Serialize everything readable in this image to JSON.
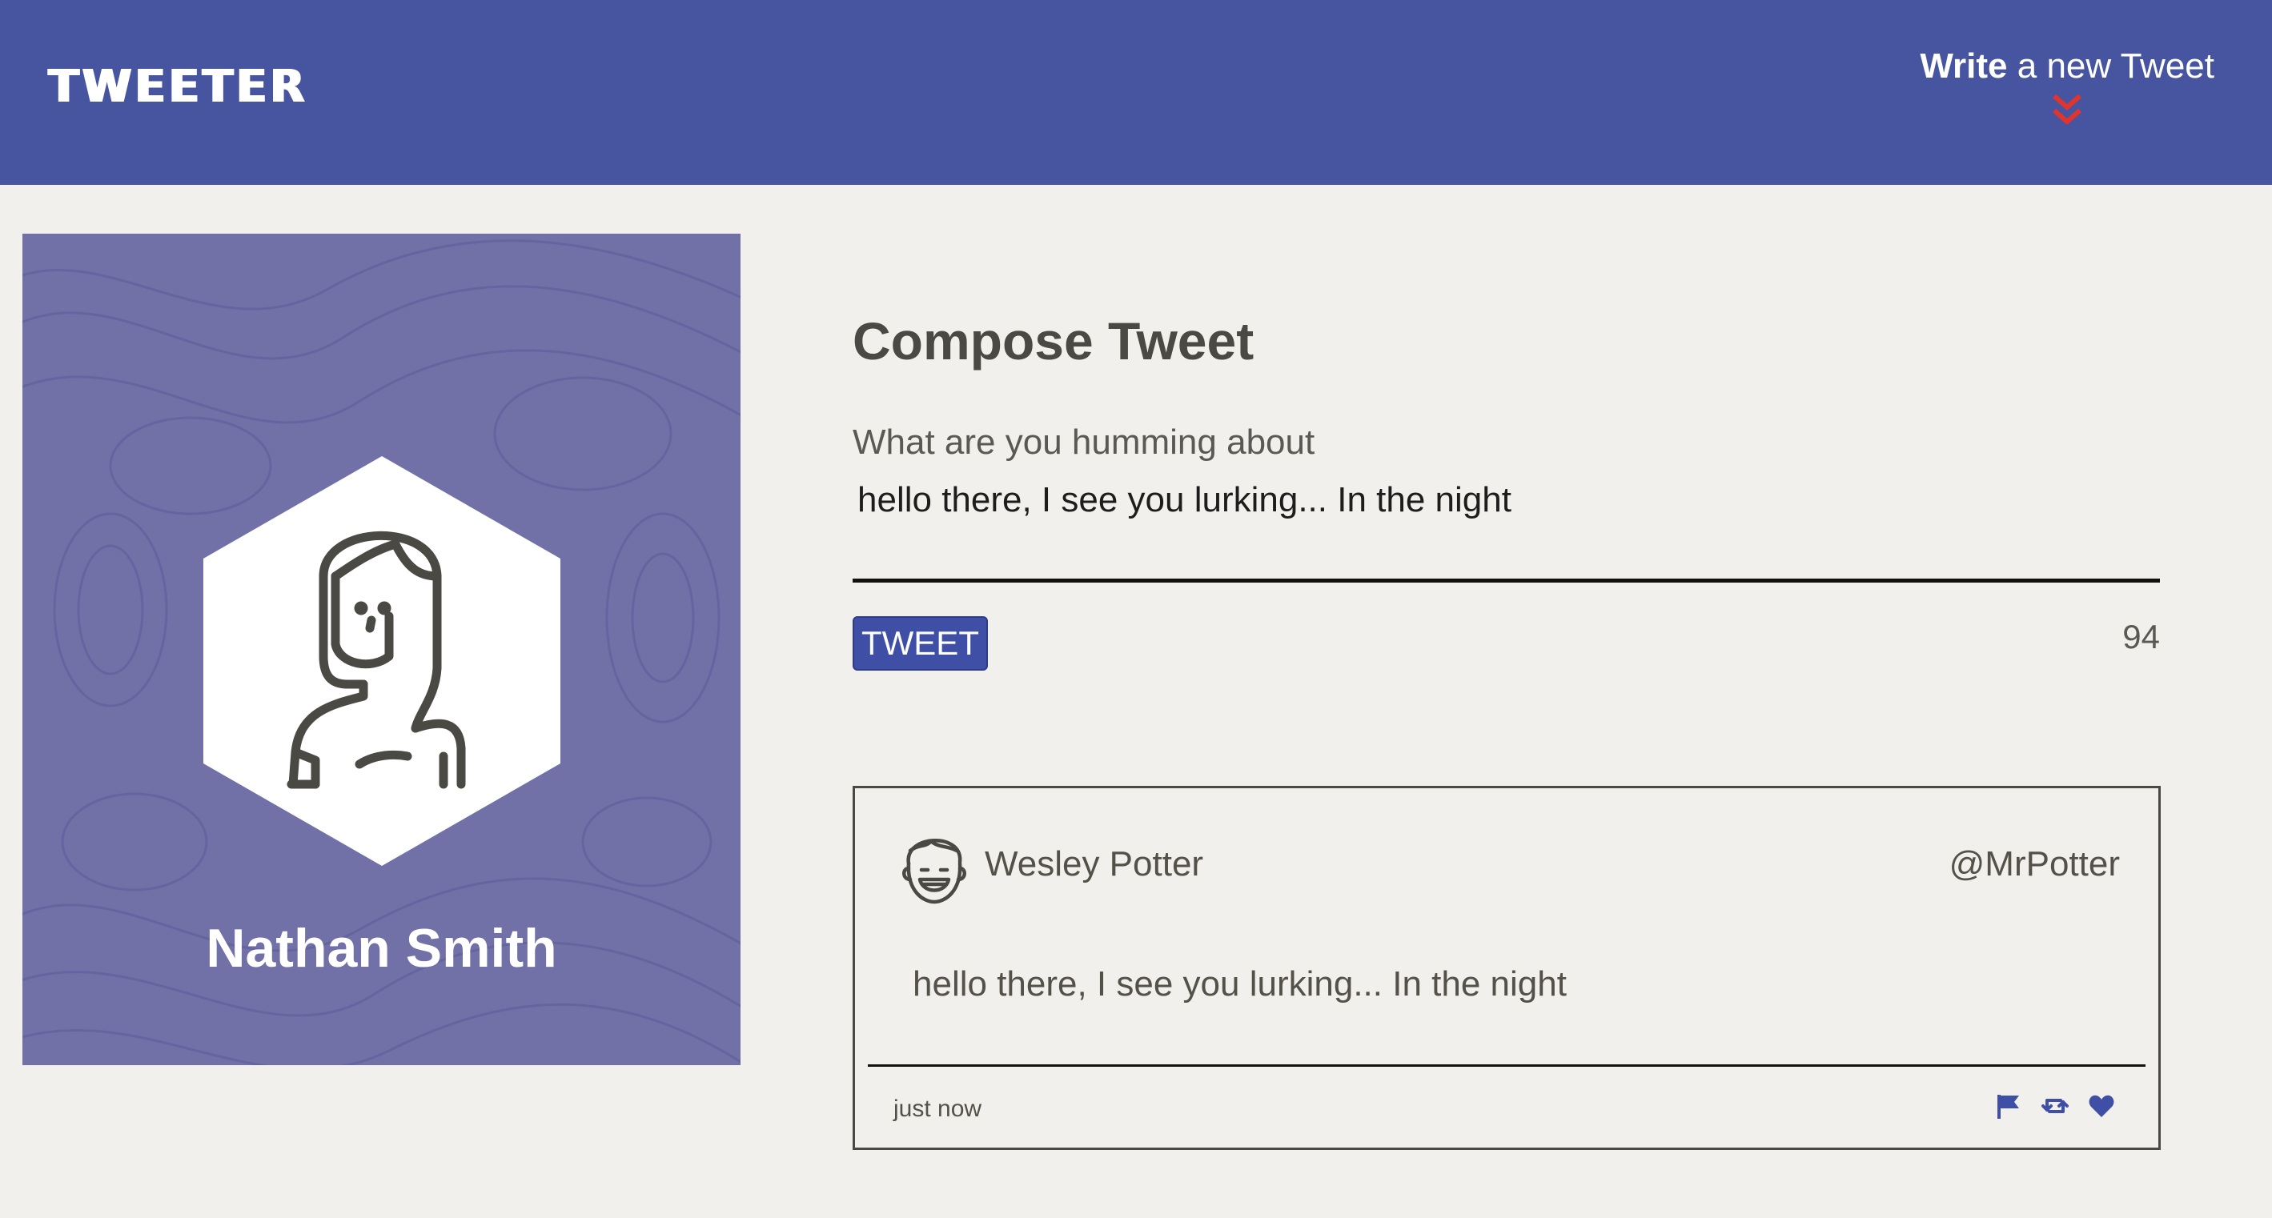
{
  "nav": {
    "logo": "TWEETER",
    "write_bold": "Write",
    "write_rest": " a new Tweet"
  },
  "profile": {
    "name": "Nathan Smith"
  },
  "compose": {
    "title": "Compose Tweet",
    "prompt": "What are you humming about",
    "input_value": "hello there, I see you lurking... In the night",
    "button_label": "TWEET",
    "counter": "94"
  },
  "tweet": {
    "author": "Wesley Potter",
    "handle": "@MrPotter",
    "content": "hello there, I see you lurking... In the night",
    "timestamp": "just now",
    "actions": [
      "flag-icon",
      "retweet-icon",
      "heart-icon"
    ]
  },
  "colors": {
    "nav_bg": "#4755a0",
    "page_bg": "#f2f0ec",
    "profile_bg": "#7171a8",
    "accent": "#3e4fa5",
    "chevron": "#e0342c"
  }
}
